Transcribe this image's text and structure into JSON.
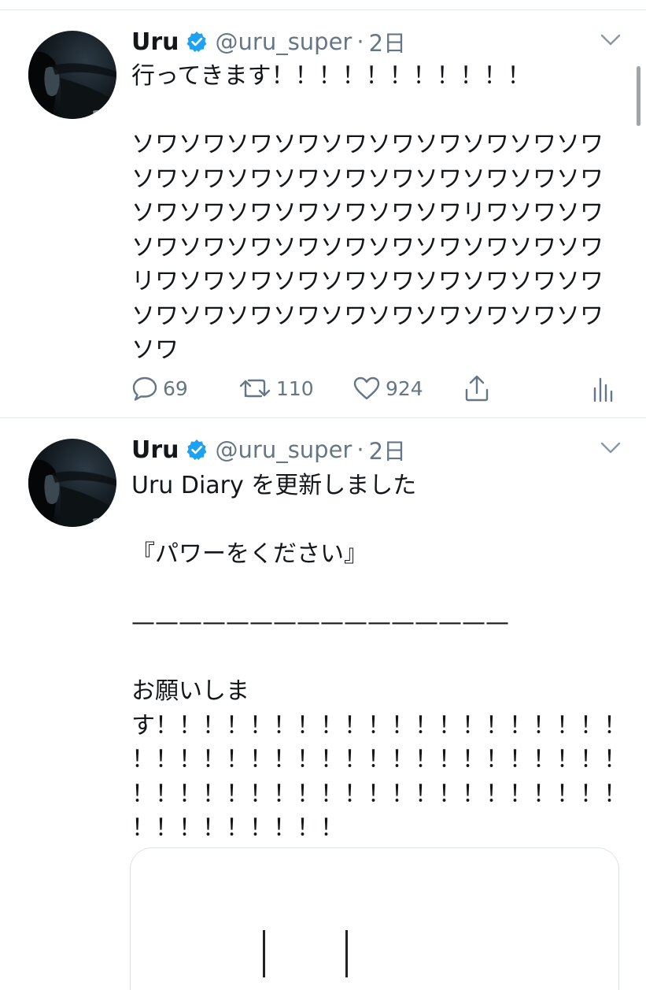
{
  "tweets": [
    {
      "name": "Uru",
      "handle": "@uru_super",
      "separator": "·",
      "time": "2日",
      "text": "行ってきます！！！！！！！！！！！\n\nソワソワソワソワソワソワソワソワソワソワ\nソワソワソワソワソワソワソワソワソワソワ\nソワソワソワソワソワソワソワリワソワソワ\nソワソワソワソワソワソワソワソワソワソワ\nリワソワソワソワソワソワソワソワソワソワ\nソワソワソワソワソワソワソワソワソワソワ\nソワ",
      "actions": {
        "reply_count": "69",
        "retweet_count": "110",
        "like_count": "924"
      }
    },
    {
      "name": "Uru",
      "handle": "@uru_super",
      "separator": "·",
      "time": "2日",
      "text": "Uru Diary を更新しました\n\n『パワーをください』\n\n————————————————\n\nお願いしま\nす！！！！！！！！！！！！！！！！！！！！\n！！！！！！！！！！！！！！！！！！！！！\n！！！！！！！！！！！！！！！！！！！！！\n！！！！！！！！！"
    }
  ],
  "icons": {
    "verified": "verified-badge-icon",
    "chevron": "chevron-down-icon",
    "reply": "reply-icon",
    "retweet": "retweet-icon",
    "like": "heart-icon",
    "share": "share-icon",
    "stats": "analytics-icon"
  },
  "colors": {
    "text": "#14171a",
    "secondary": "#657786",
    "verified": "#1da1f2",
    "divider": "#e1e8ed"
  }
}
